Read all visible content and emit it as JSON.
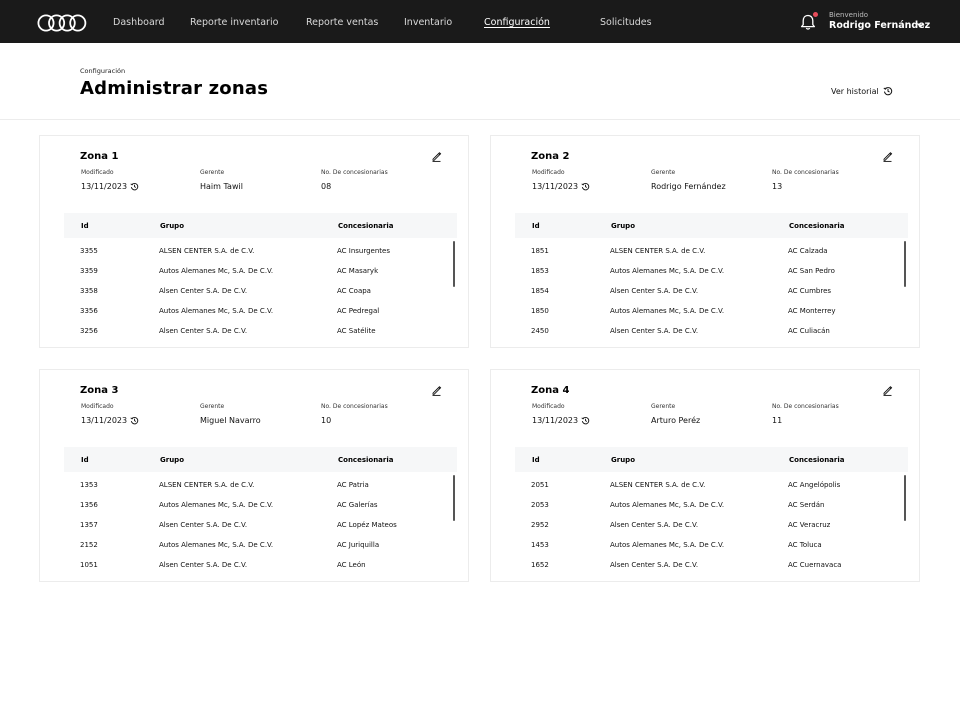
{
  "nav": {
    "items": [
      "Dashboard",
      "Reporte inventario",
      "Reporte ventas",
      "Inventario",
      "Configuración",
      "Solicitudes"
    ],
    "active": "Configuración"
  },
  "user": {
    "welcome": "Bienvenido",
    "name": "Rodrigo Fernández"
  },
  "page": {
    "breadcrumb": "Configuración",
    "title": "Administrar zonas",
    "history_label": "Ver historial"
  },
  "labels": {
    "modified": "Modificado",
    "manager": "Gerente",
    "dealer_count": "No. De concesionarias"
  },
  "table_headers": [
    "Id",
    "Grupo",
    "Concesionaria"
  ],
  "zones": [
    {
      "title": "Zona 1",
      "modified": "13/11/2023",
      "manager": "Haim Tawil",
      "count": "08",
      "rows": [
        [
          "3355",
          "ALSEN CENTER S.A. de  C.V.",
          "AC Insurgentes"
        ],
        [
          "3359",
          "Autos Alemanes Mc, S.A. De C.V.",
          "AC Masaryk"
        ],
        [
          "3358",
          "Alsen Center S.A. De  C.V.",
          "AC Coapa"
        ],
        [
          "3356",
          "Autos Alemanes Mc, S.A. De C.V.",
          "AC Pedregal"
        ],
        [
          "3256",
          "Alsen Center S.A. De  C.V.",
          "AC Satélite"
        ]
      ]
    },
    {
      "title": "Zona 2",
      "modified": "13/11/2023",
      "manager": "Rodrigo Fernández",
      "count": "13",
      "rows": [
        [
          "1851",
          "ALSEN CENTER S.A. de  C.V.",
          "AC Calzada"
        ],
        [
          "1853",
          "Autos Alemanes Mc, S.A. De C.V.",
          "AC San Pedro"
        ],
        [
          "1854",
          "Alsen Center S.A. De  C.V.",
          "AC Cumbres"
        ],
        [
          "1850",
          "Autos Alemanes Mc, S.A. De C.V.",
          "AC Monterrey"
        ],
        [
          "2450",
          "Alsen Center S.A. De  C.V.",
          "AC Culiacán"
        ]
      ]
    },
    {
      "title": "Zona 3",
      "modified": "13/11/2023",
      "manager": "Miguel Navarro",
      "count": "10",
      "rows": [
        [
          "1353",
          "ALSEN CENTER S.A. de  C.V.",
          "AC Patria"
        ],
        [
          "1356",
          "Autos Alemanes Mc, S.A. De C.V.",
          "AC Galerías"
        ],
        [
          "1357",
          "Alsen Center S.A. De  C.V.",
          "AC Lopéz Mateos"
        ],
        [
          "2152",
          "Autos Alemanes Mc, S.A. De C.V.",
          "AC Juriquilla"
        ],
        [
          "1051",
          "Alsen Center S.A. De  C.V.",
          "AC León"
        ]
      ]
    },
    {
      "title": "Zona 4",
      "modified": "13/11/2023",
      "manager": "Arturo Peréz",
      "count": "11",
      "rows": [
        [
          "2051",
          "ALSEN CENTER S.A. de  C.V.",
          "AC Angelópolis"
        ],
        [
          "2053",
          "Autos Alemanes Mc, S.A. De C.V.",
          "AC Serdán"
        ],
        [
          "2952",
          "Alsen Center S.A. De  C.V.",
          "AC Veracruz"
        ],
        [
          "1453",
          "Autos Alemanes Mc, S.A. De C.V.",
          "AC Toluca"
        ],
        [
          "1652",
          "Alsen Center S.A. De  C.V.",
          "AC Cuernavaca"
        ]
      ]
    }
  ]
}
